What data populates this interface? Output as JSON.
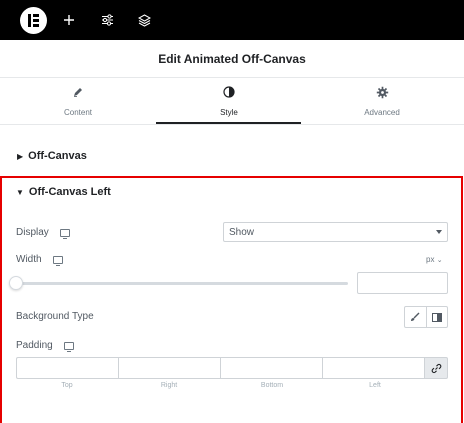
{
  "topbar": {
    "logo_icon": "elementor-logo-icon",
    "tools": [
      "add-icon",
      "sliders-icon",
      "layers-icon"
    ]
  },
  "panel": {
    "title": "Edit Animated Off-Canvas"
  },
  "tabs": [
    {
      "label": "Content",
      "icon": "pencil-icon",
      "active": false
    },
    {
      "label": "Style",
      "icon": "half-circle-icon",
      "active": true
    },
    {
      "label": "Advanced",
      "icon": "gear-icon",
      "active": false
    }
  ],
  "sections": {
    "collapsed": {
      "title": "Off-Canvas"
    },
    "open": {
      "title": "Off-Canvas Left"
    }
  },
  "controls": {
    "display": {
      "label": "Display",
      "value": "Show"
    },
    "width": {
      "label": "Width",
      "unit": "px",
      "slider_value_fraction": 0.0,
      "value": ""
    },
    "background_type": {
      "label": "Background Type",
      "options": [
        "brush-icon",
        "gradient-icon"
      ]
    },
    "padding": {
      "label": "Padding",
      "fields": [
        {
          "label": "Top",
          "value": ""
        },
        {
          "label": "Right",
          "value": ""
        },
        {
          "label": "Bottom",
          "value": ""
        },
        {
          "label": "Left",
          "value": ""
        }
      ]
    }
  },
  "colors": {
    "topbar": "#000000",
    "highlight": "#e60000",
    "text": "#515962",
    "heading": "#1f2124"
  }
}
